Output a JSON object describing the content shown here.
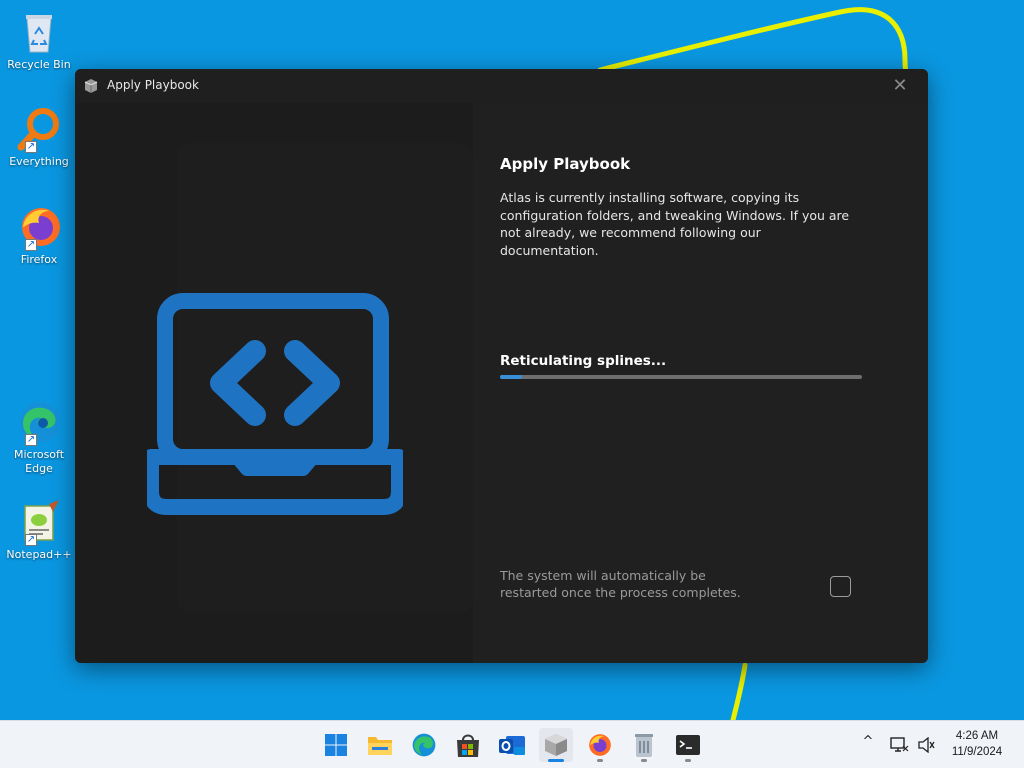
{
  "desktop": {
    "icons": [
      {
        "label": "Recycle Bin",
        "icon": "recycle-bin-icon"
      },
      {
        "label": "Everything",
        "icon": "everything-search-icon"
      },
      {
        "label": "Firefox",
        "icon": "firefox-icon"
      },
      {
        "label": "Microsoft Edge",
        "icon": "edge-icon"
      },
      {
        "label": "Notepad++",
        "icon": "notepad-plus-plus-icon"
      }
    ],
    "background_color": "#0a97e1",
    "annotation_color": "#e8f000"
  },
  "window": {
    "title": "Apply Playbook",
    "close_glyph": "✕",
    "heading": "Apply Playbook",
    "description": "Atlas is currently installing software, copying its configuration folders, and tweaking Windows. If you are not already, we recommend following our documentation.",
    "status": "Reticulating splines...",
    "progress_fraction": 0.06,
    "restart_note": "The system will automatically be restarted once the process completes.",
    "restart_checked": false,
    "accent_color": "#1f73c3",
    "illustration_icon": "laptop-code-icon"
  },
  "taskbar": {
    "apps": [
      "start",
      "file-explorer",
      "edge",
      "microsoft-store",
      "outlook",
      "atlas-toolbox",
      "firefox",
      "recycle-bin",
      "terminal"
    ],
    "active_app": "atlas-toolbox",
    "tray_chevron": "^",
    "time": "4:26 AM",
    "date": "11/9/2024"
  }
}
